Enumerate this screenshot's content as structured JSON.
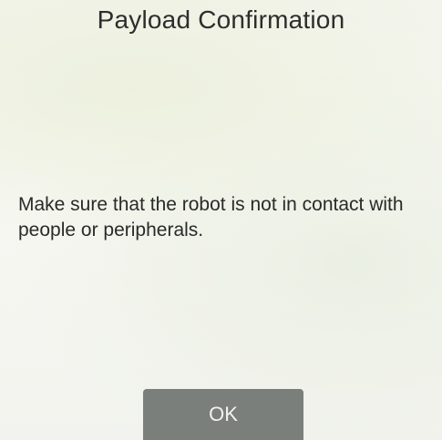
{
  "dialog": {
    "title": "Payload Confirmation",
    "message": "Make sure that the robot is not in contact with people or peripherals.",
    "ok_label": "OK"
  },
  "colors": {
    "button_background": "#7a7f7b",
    "button_text": "#f2f2f2",
    "text": "#2d2d2d"
  }
}
